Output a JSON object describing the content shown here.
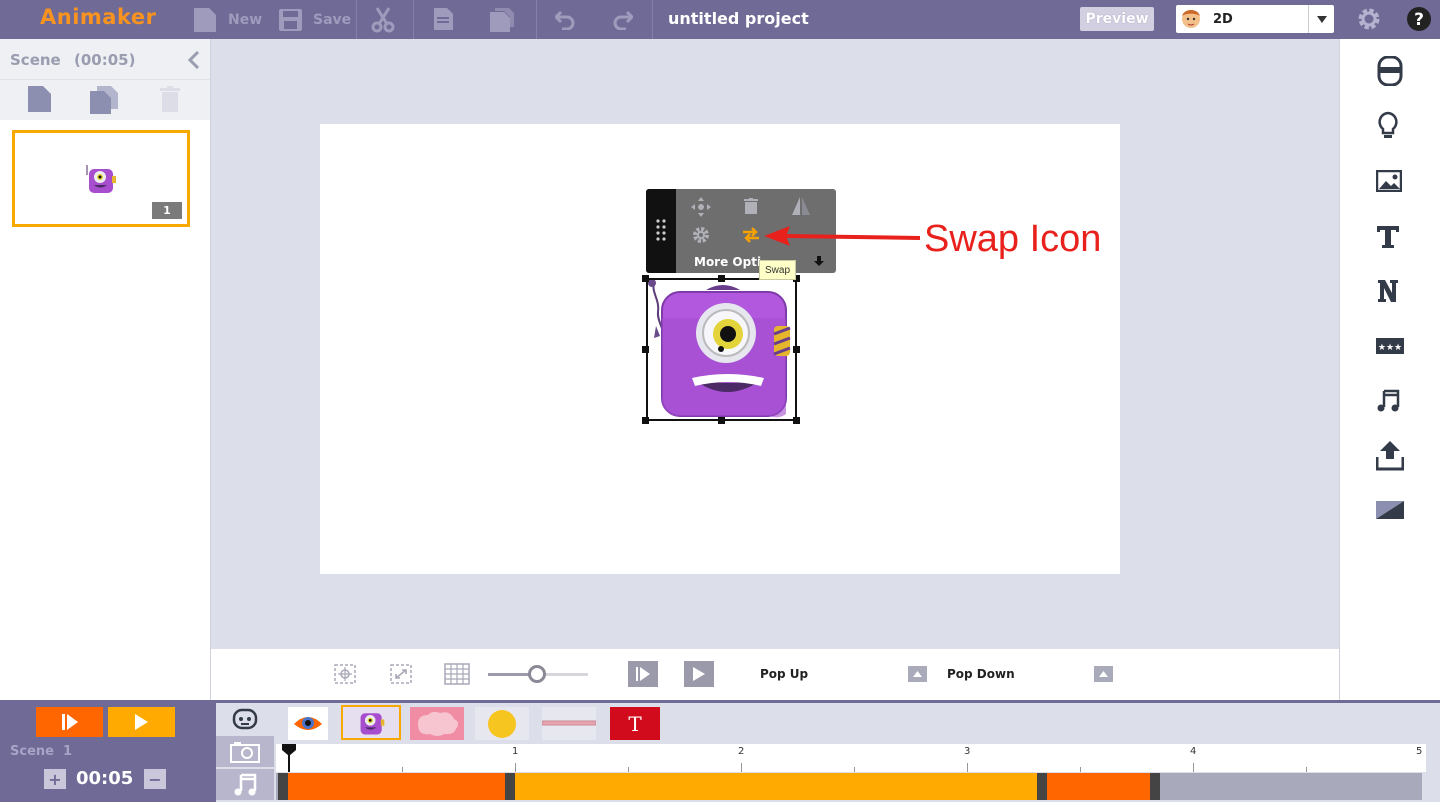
{
  "app": {
    "logo": "Animaker",
    "project_title": "untitled project"
  },
  "toolbar": {
    "new_label": "New",
    "save_label": "Save",
    "preview_label": "Preview",
    "mode_value": "2D"
  },
  "scene_panel": {
    "title": "Scene",
    "duration": "(00:05)",
    "scenes": [
      {
        "number": "1"
      }
    ]
  },
  "context_menu": {
    "more_options_label": "More Opti",
    "tooltip": "Swap"
  },
  "annotation": {
    "text": "Swap Icon"
  },
  "animation_bar": {
    "enter_label": "Pop Up",
    "exit_label": "Pop Down"
  },
  "timeline": {
    "scene_label": "Scene  1",
    "time": "00:05",
    "plus_label": "+",
    "minus_label": "−",
    "ruler_ticks": [
      "1",
      "2",
      "3",
      "4",
      "5"
    ],
    "text_item_label": "T"
  },
  "colors": {
    "topbar": "#6f6a96",
    "accent_orange": "#ff6600",
    "accent_yellow": "#ffaa00",
    "selection": "#f9a800",
    "annotation": "#e8211c"
  }
}
